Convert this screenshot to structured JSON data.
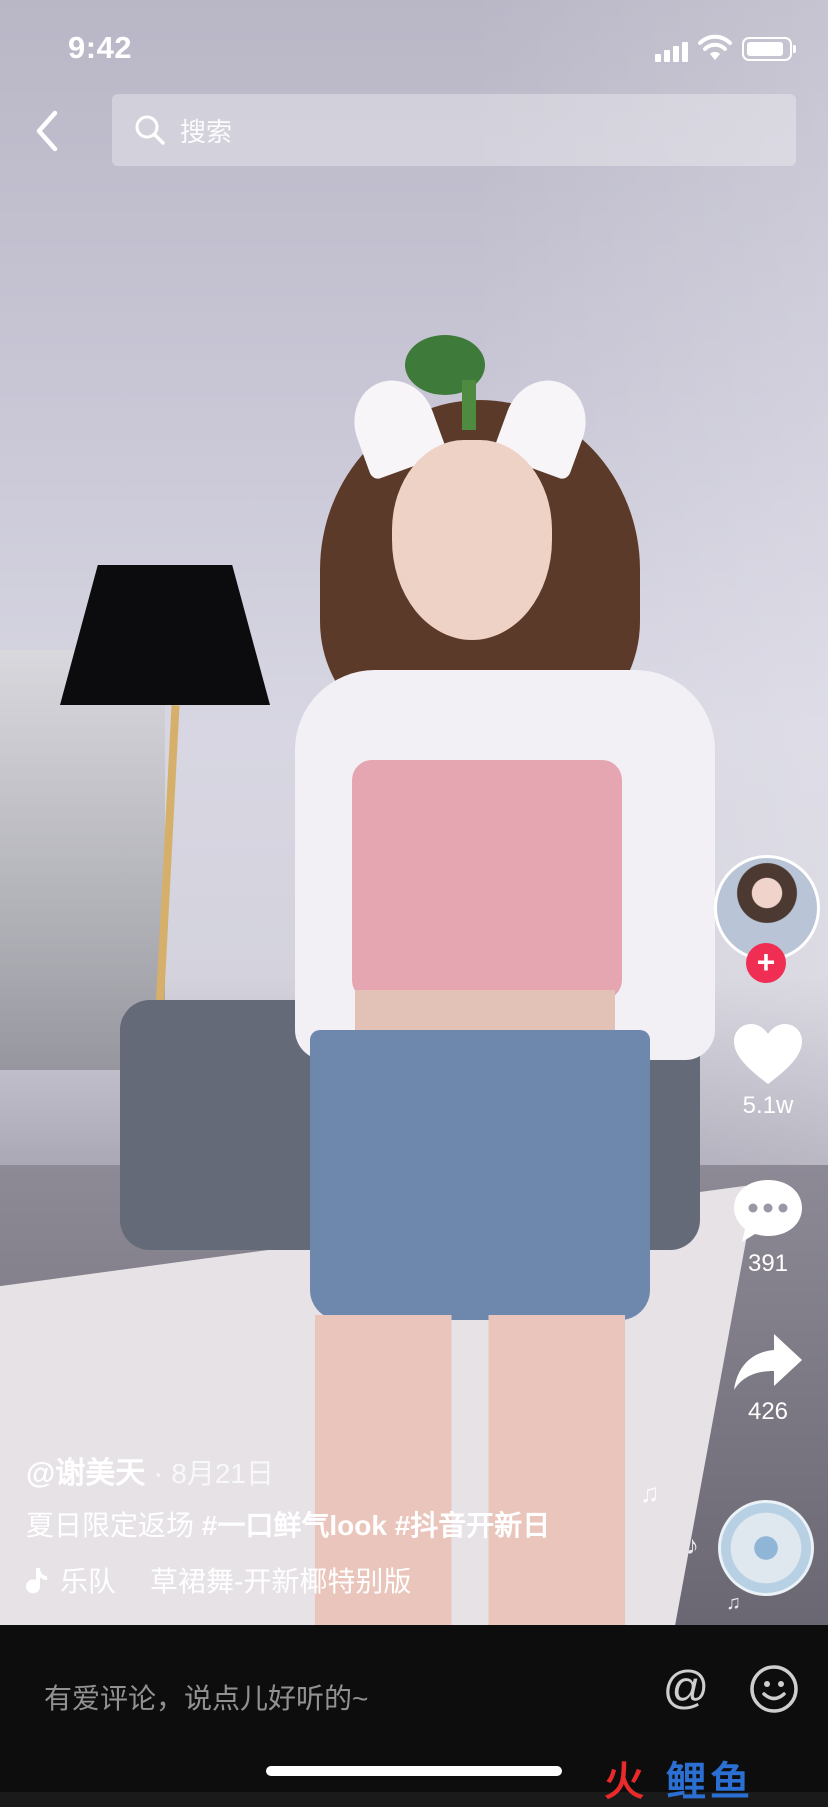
{
  "status_bar": {
    "time": "9:42"
  },
  "header": {
    "search_placeholder": "搜索"
  },
  "actions": {
    "like_count": "5.1w",
    "comment_count": "391",
    "share_count": "426",
    "follow_symbol": "+"
  },
  "caption": {
    "author": "@谢美天",
    "separator": "·",
    "date": "8月21日",
    "text": "夏日限定返场 ",
    "hashtag_1": "#一口鲜气look",
    "hashtag_2": "#抖音开新日",
    "music_artist": "乐队",
    "music_title": "草裙舞-开新椰特别版"
  },
  "comment_bar": {
    "placeholder": "有爱评论，说点儿好听的~",
    "at_symbol": "@"
  },
  "watermark": {
    "fire": "火",
    "carp": "鲤鱼"
  },
  "icons": [
    "chevron-left-icon",
    "search-icon",
    "signal-icon",
    "wifi-icon",
    "battery-icon",
    "heart-icon",
    "comment-icon",
    "share-icon",
    "music-note-icon",
    "emoji-icon"
  ],
  "colors": {
    "follow_badge": "#f02d52",
    "comment_bar_bg": "#0d0d0e"
  }
}
